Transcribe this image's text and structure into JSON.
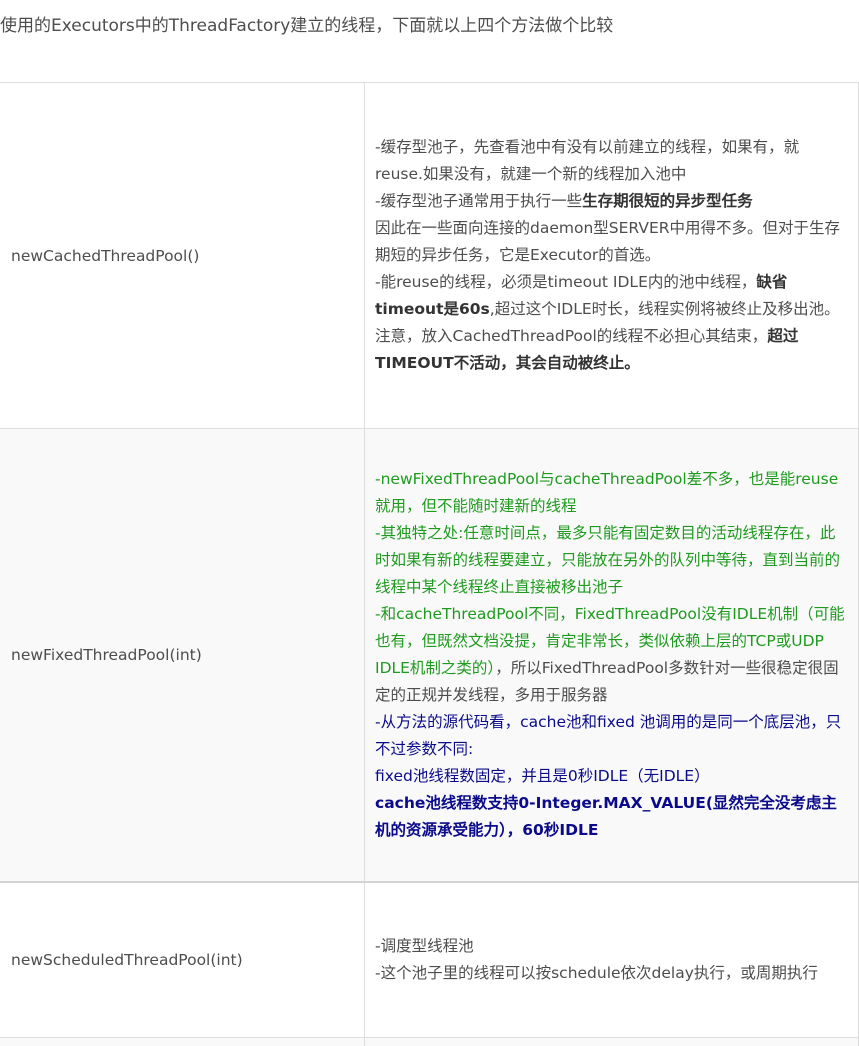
{
  "intro": "使用的Executors中的ThreadFactory建立的线程，下面就以上四个方法做个比较",
  "rows": [
    {
      "name": "newCachedThreadPool()",
      "desc": [
        [
          {
            "t": "-缓存型池子，先查看池中有没有以前建立的线程，如果有，就 reuse.如果没有，就建一个新的线程加入池中"
          }
        ],
        [
          {
            "t": "-缓存型池子通常用于执行一些"
          },
          {
            "t": "生存期很短的异步型任务",
            "s": "bold"
          }
        ],
        [
          {
            "t": " 因此在一些面向连接的daemon型SERVER中用得不多。但对于生存期短的异步任务，它是Executor的首选。"
          }
        ],
        [
          {
            "t": "-能reuse的线程，必须是timeout IDLE内的池中线程，"
          },
          {
            "t": "缺省 timeout是60s",
            "s": "bold"
          },
          {
            "t": ",超过这个IDLE时长，线程实例将被终止及移出池。"
          }
        ],
        [
          {
            "t": "  注意，放入CachedThreadPool的线程不必担心其结束，"
          },
          {
            "t": "超过TIMEOUT不活动，其会自动被终止。",
            "s": "bold"
          }
        ]
      ]
    },
    {
      "name": "newFixedThreadPool(int)",
      "desc": [
        [
          {
            "t": "-newFixedThreadPool与cacheThreadPool差不多，也是能reuse就用，但不能随时建新的线程",
            "s": "g"
          }
        ],
        [
          {
            "t": "-其独特之处:任意时间点，最多只能有固定数目的活动线程存在，此时如果有新的线程要建立，只能放在另外的队列中等待，直到当前的线程中某个线程终止直接被移出池子",
            "s": "g"
          }
        ],
        [
          {
            "t": "-和cacheThreadPool不同，FixedThreadPool没有IDLE机制（可能也有，但既然文档没提，肯定非常长，类似依赖上层的TCP或UDP IDLE机制之类的）",
            "s": "g"
          },
          {
            "t": "，所以FixedThreadPool多数针对一些很稳定很固定的正规并发线程，多用于服务器"
          }
        ],
        [
          {
            "t": "-从方法的源代码看，cache池和fixed 池调用的是同一个底层池，只不过参数不同:",
            "s": "b"
          }
        ],
        [
          {
            "t": "fixed池线程数固定，并且是0秒IDLE（无IDLE）",
            "s": "b"
          }
        ],
        [
          {
            "t": "cache池线程数支持0-Integer.MAX_VALUE(显然完全没考虑主机的资源承受能力），60秒IDLE",
            "s": "b bold"
          }
        ]
      ]
    },
    {
      "name": "newScheduledThreadPool(int)",
      "desc": [
        [
          {
            "t": "-调度型线程池"
          }
        ],
        [
          {
            "t": "-这个池子里的线程可以按schedule依次delay执行，或周期执行"
          }
        ]
      ]
    },
    {
      "name": "",
      "desc": []
    }
  ]
}
